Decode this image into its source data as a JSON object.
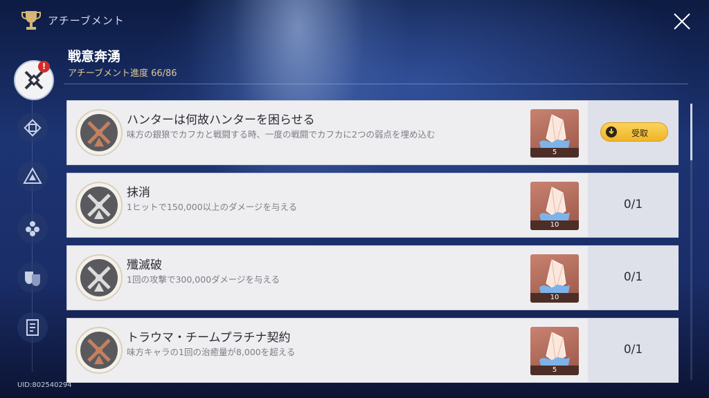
{
  "header": {
    "title": "アチーブメント",
    "trophy_icon": "trophy-icon",
    "close_icon": "close-icon"
  },
  "sidebar": {
    "badge": "!",
    "uid": "UID:802540294",
    "categories": [
      {
        "icon": "crossed-swords-icon",
        "active": true
      },
      {
        "icon": "emblem-icon"
      },
      {
        "icon": "triangle-crest-icon"
      },
      {
        "icon": "flower-crest-icon"
      },
      {
        "icon": "theater-masks-icon"
      },
      {
        "icon": "notebook-icon"
      }
    ]
  },
  "category": {
    "title": "戦意奔湧",
    "progress": "アチーブメント進度 66/86"
  },
  "achievements": [
    {
      "name": "ハンターは何故ハンターを困らせる",
      "description": "味方の銀狼でカフカと戦闘する時、一度の戦闘でカフカに2つの弱点を埋め込む",
      "reward_qty": "5",
      "emblem": "bronze",
      "claim_label": "受取"
    },
    {
      "name": "抹消",
      "description": "1ヒットで150,000以上のダメージを与える",
      "reward_qty": "10",
      "emblem": "silver",
      "progress": "0/1"
    },
    {
      "name": "殲滅破",
      "description": "1回の攻撃で300,000ダメージを与える",
      "reward_qty": "10",
      "emblem": "silver",
      "progress": "0/1"
    },
    {
      "name": "トラウマ・チームプラチナ契約",
      "description": "味方キャラの1回の治癒量が8,000を超える",
      "reward_qty": "5",
      "emblem": "bronze",
      "progress": "0/1"
    }
  ],
  "colors": {
    "bronze": "#c4805e",
    "silver": "#dcdcdc",
    "claim": "#f5c542",
    "badge": "#d42a2a"
  }
}
